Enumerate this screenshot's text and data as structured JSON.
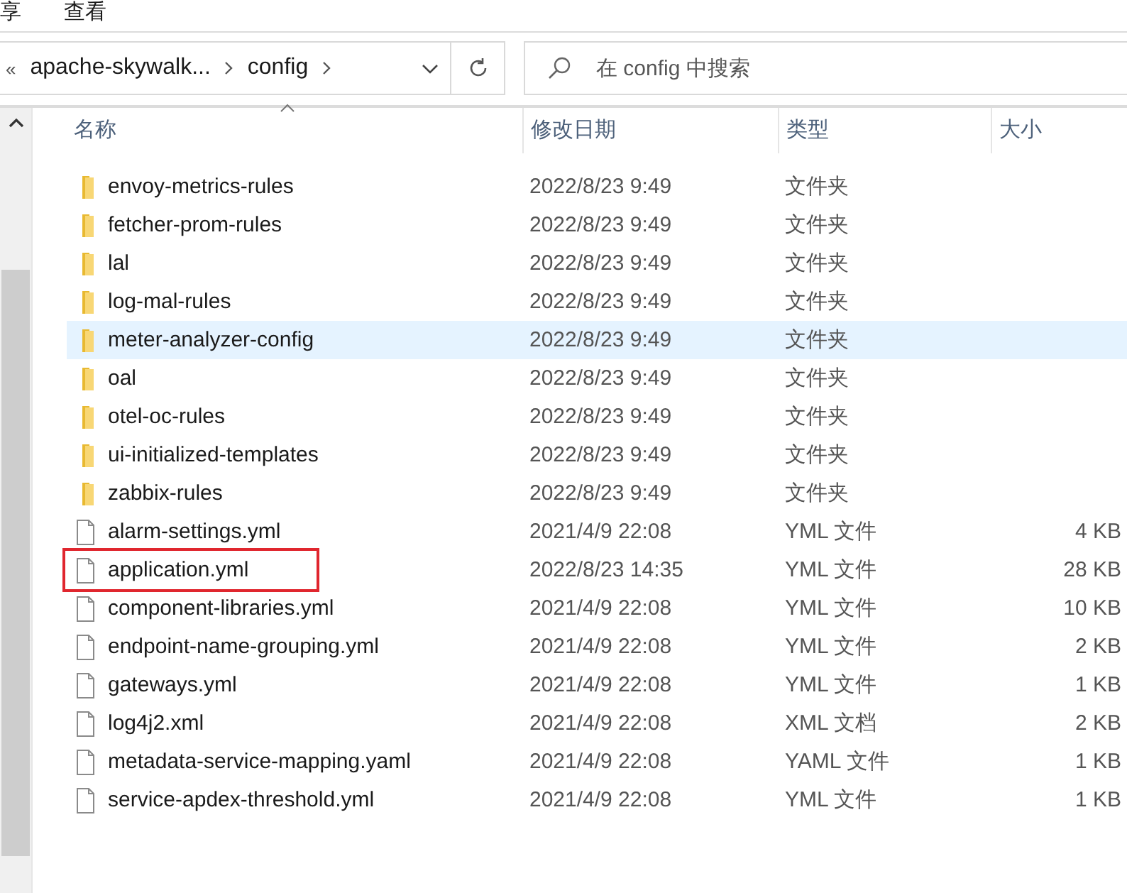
{
  "ribbon_tabs": [
    {
      "label": "享"
    },
    {
      "label": "查看"
    }
  ],
  "address_bar": {
    "overflow": "«",
    "crumbs": [
      "apache-skywalk...",
      "config"
    ]
  },
  "search": {
    "placeholder": "在 config 中搜索"
  },
  "table": {
    "columns": [
      "名称",
      "修改日期",
      "类型",
      "大小"
    ],
    "rows": [
      {
        "kind": "folder",
        "name": "envoy-metrics-rules",
        "date": "2022/8/23 9:49",
        "type": "文件夹",
        "hovered": false,
        "annotated": false
      },
      {
        "kind": "folder",
        "name": "fetcher-prom-rules",
        "date": "2022/8/23 9:49",
        "type": "文件夹",
        "hovered": false,
        "annotated": false
      },
      {
        "kind": "folder",
        "name": "lal",
        "date": "2022/8/23 9:49",
        "type": "文件夹",
        "hovered": false,
        "annotated": false
      },
      {
        "kind": "folder",
        "name": "log-mal-rules",
        "date": "2022/8/23 9:49",
        "type": "文件夹",
        "hovered": false,
        "annotated": false
      },
      {
        "kind": "folder",
        "name": "meter-analyzer-config",
        "date": "2022/8/23 9:49",
        "type": "文件夹",
        "hovered": true,
        "annotated": false
      },
      {
        "kind": "folder",
        "name": "oal",
        "date": "2022/8/23 9:49",
        "type": "文件夹",
        "hovered": false,
        "annotated": false
      },
      {
        "kind": "folder",
        "name": "otel-oc-rules",
        "date": "2022/8/23 9:49",
        "type": "文件夹",
        "hovered": false,
        "annotated": false
      },
      {
        "kind": "folder",
        "name": "ui-initialized-templates",
        "date": "2022/8/23 9:49",
        "type": "文件夹",
        "hovered": false,
        "annotated": false
      },
      {
        "kind": "folder",
        "name": "zabbix-rules",
        "date": "2022/8/23 9:49",
        "type": "文件夹",
        "hovered": false,
        "annotated": false
      },
      {
        "kind": "file",
        "name": "alarm-settings.yml",
        "date": "2021/4/9 22:08",
        "type": "YML 文件",
        "size": "4 KB",
        "hovered": false,
        "annotated": false
      },
      {
        "kind": "file",
        "name": "application.yml",
        "date": "2022/8/23 14:35",
        "type": "YML 文件",
        "size": "28 KB",
        "hovered": false,
        "annotated": true
      },
      {
        "kind": "file",
        "name": "component-libraries.yml",
        "date": "2021/4/9 22:08",
        "type": "YML 文件",
        "size": "10 KB",
        "hovered": false,
        "annotated": false
      },
      {
        "kind": "file",
        "name": "endpoint-name-grouping.yml",
        "date": "2021/4/9 22:08",
        "type": "YML 文件",
        "size": "2 KB",
        "hovered": false,
        "annotated": false
      },
      {
        "kind": "file",
        "name": "gateways.yml",
        "date": "2021/4/9 22:08",
        "type": "YML 文件",
        "size": "1 KB",
        "hovered": false,
        "annotated": false
      },
      {
        "kind": "file",
        "name": "log4j2.xml",
        "date": "2021/4/9 22:08",
        "type": "XML 文档",
        "size": "2 KB",
        "hovered": false,
        "annotated": false
      },
      {
        "kind": "file",
        "name": "metadata-service-mapping.yaml",
        "date": "2021/4/9 22:08",
        "type": "YAML 文件",
        "size": "1 KB",
        "hovered": false,
        "annotated": false
      },
      {
        "kind": "file",
        "name": "service-apdex-threshold.yml",
        "date": "2021/4/9 22:08",
        "type": "YML 文件",
        "size": "1 KB",
        "hovered": false,
        "annotated": false
      }
    ]
  }
}
